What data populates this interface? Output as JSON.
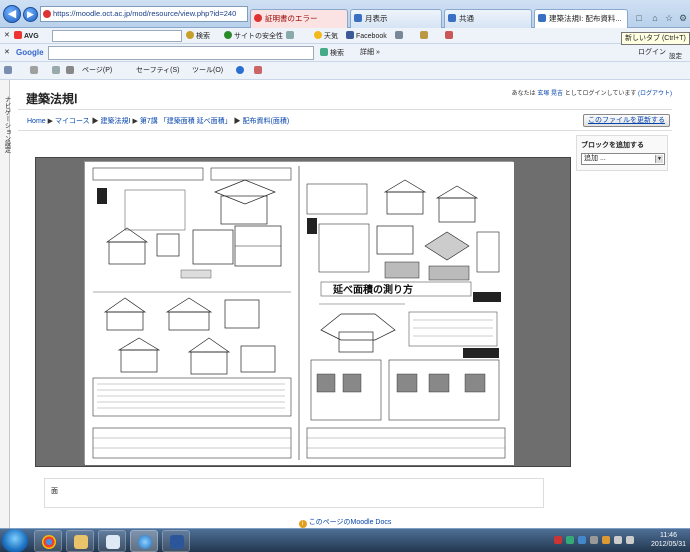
{
  "browser": {
    "url": "https://moodle.oct.ac.jp/mod/resource/view.php?id=240",
    "tabs": [
      {
        "label": "証明書のエラー"
      },
      {
        "label": "月表示"
      },
      {
        "label": "共通"
      },
      {
        "label": "建築法規Ⅰ: 配布資料..."
      }
    ],
    "tooltip": "新しいタブ (Ctrl+T)"
  },
  "toolbar1": {
    "avg": "AVG",
    "search": "検索",
    "site_safety": "サイトの安全性",
    "weather": "天気",
    "facebook": "Facebook"
  },
  "toolbar2": {
    "google": "Google",
    "search": "検索",
    "details": "詳細 »",
    "login": "ログイン",
    "settings": "設定"
  },
  "toolbar3": {
    "page": "ページ(P)",
    "safety": "セーフティ(S)",
    "tools": "ツール(O)"
  },
  "moodle": {
    "dock_label": "ナビゲーション",
    "dock_label2": "設定",
    "course_title": "建築法規Ⅰ",
    "login_prefix": "あなたは",
    "login_user": "玄塚 晃吉",
    "login_suffix": "としてログインしています",
    "logout": "(ログアウト)",
    "breadcrumb": [
      "Home",
      "マイコース",
      "建築法規Ⅰ",
      "第7講 「建築面積 延べ面積」",
      "配布資料(面積)"
    ],
    "update_button": "このファイルを更新する",
    "blocks_header": "ブロックを追加する",
    "blocks_select": "追加 ...",
    "description": "面",
    "footer": "このページのMoodle Docs"
  },
  "taskbar": {
    "time": "11:46",
    "date": "2012/05/31"
  }
}
